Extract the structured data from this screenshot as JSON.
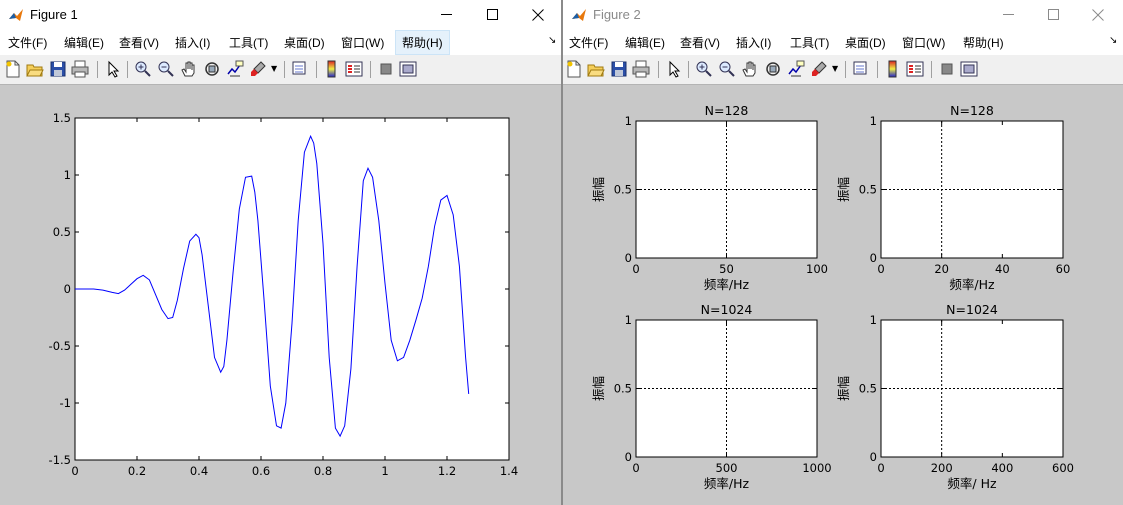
{
  "windows": [
    {
      "title": "Figure 1",
      "menus": [
        "文件(F)",
        "编辑(E)",
        "查看(V)",
        "插入(I)",
        "工具(T)",
        "桌面(D)",
        "窗口(W)",
        "帮助(H)"
      ],
      "highlighted_menu": "帮助(H)"
    },
    {
      "title": "Figure 2",
      "menus": [
        "文件(F)",
        "编辑(E)",
        "查看(V)",
        "插入(I)",
        "工具(T)",
        "桌面(D)",
        "窗口(W)",
        "帮助(H)"
      ]
    }
  ],
  "toolbar_icons": [
    "new-figure-icon",
    "open-file-icon",
    "save-icon",
    "print-icon",
    "edit-plot-arrow-icon",
    "zoom-in-icon",
    "zoom-out-icon",
    "pan-hand-icon",
    "rotate-3d-icon",
    "data-cursor-icon",
    "brush-icon",
    "link-plot-icon",
    "colorbar-icon",
    "legend-icon",
    "hide-plot-tools-icon",
    "show-plot-tools-icon"
  ],
  "colors": {
    "series": "#0000ff",
    "figure_bg": "#c8c8c8",
    "axes_bg": "#ffffff",
    "matlab_orange": "#e8780c"
  },
  "chart_data": [
    {
      "type": "line",
      "figure": "Figure 1",
      "title": "",
      "xlabel": "",
      "ylabel": "",
      "xlim": [
        0,
        1.4
      ],
      "ylim": [
        -1.5,
        1.5
      ],
      "xticks": [
        "0",
        "0.2",
        "0.4",
        "0.6",
        "0.8",
        "1",
        "1.2",
        "1.4"
      ],
      "yticks": [
        "1.5",
        "1",
        "0.5",
        "0",
        "-0.5",
        "-1",
        "-1.5"
      ],
      "grid": false,
      "series": [
        {
          "x": [
            0,
            0.03,
            0.06,
            0.09,
            0.12,
            0.14,
            0.16,
            0.18,
            0.2,
            0.22,
            0.24,
            0.26,
            0.28,
            0.3,
            0.315,
            0.33,
            0.35,
            0.37,
            0.39,
            0.4,
            0.41,
            0.43,
            0.45,
            0.47,
            0.48,
            0.49,
            0.51,
            0.53,
            0.55,
            0.57,
            0.58,
            0.59,
            0.61,
            0.63,
            0.65,
            0.665,
            0.68,
            0.7,
            0.72,
            0.74,
            0.76,
            0.77,
            0.78,
            0.8,
            0.82,
            0.84,
            0.855,
            0.87,
            0.89,
            0.91,
            0.93,
            0.945,
            0.96,
            0.98,
            1.0,
            1.02,
            1.04,
            1.06,
            1.08,
            1.1,
            1.12,
            1.14,
            1.16,
            1.18,
            1.2,
            1.22,
            1.24,
            1.26,
            1.27
          ],
          "y": [
            0,
            0,
            0,
            -0.01,
            -0.03,
            -0.04,
            -0.01,
            0.04,
            0.09,
            0.12,
            0.08,
            -0.05,
            -0.18,
            -0.26,
            -0.25,
            -0.1,
            0.18,
            0.42,
            0.48,
            0.45,
            0.3,
            -0.15,
            -0.6,
            -0.73,
            -0.68,
            -0.45,
            0.15,
            0.7,
            0.98,
            0.99,
            0.85,
            0.6,
            -0.1,
            -0.85,
            -1.2,
            -1.22,
            -1.0,
            -0.3,
            0.6,
            1.2,
            1.34,
            1.28,
            1.1,
            0.4,
            -0.6,
            -1.22,
            -1.29,
            -1.2,
            -0.7,
            0.2,
            0.95,
            1.06,
            0.98,
            0.6,
            0.05,
            -0.45,
            -0.63,
            -0.6,
            -0.45,
            -0.27,
            -0.08,
            0.2,
            0.55,
            0.78,
            0.82,
            0.65,
            0.2,
            -0.6,
            -0.92
          ]
        }
      ]
    },
    {
      "type": "line",
      "figure": "Figure 2",
      "title": "N=128",
      "xlabel": "频率/Hz",
      "ylabel": "振幅",
      "xlim": [
        0,
        100
      ],
      "ylim": [
        0,
        1
      ],
      "xticks": [
        "0",
        "50",
        "100"
      ],
      "yticks": [
        "1",
        "0.5",
        "0"
      ],
      "crosshair": {
        "x": 50,
        "y": 0.5
      },
      "series": []
    },
    {
      "type": "line",
      "figure": "Figure 2",
      "title": "N=128",
      "xlabel": "频率/Hz",
      "ylabel": "振幅",
      "xlim": [
        0,
        60
      ],
      "ylim": [
        0,
        1
      ],
      "xticks": [
        "0",
        "20",
        "40",
        "60"
      ],
      "yticks": [
        "1",
        "0.5",
        "0"
      ],
      "crosshair": {
        "x": 20,
        "y": 0.5
      },
      "series": []
    },
    {
      "type": "line",
      "figure": "Figure 2",
      "title": "N=1024",
      "xlabel": "频率/Hz",
      "ylabel": "振幅",
      "xlim": [
        0,
        1000
      ],
      "ylim": [
        0,
        1
      ],
      "xticks": [
        "0",
        "500",
        "1000"
      ],
      "yticks": [
        "1",
        "0.5",
        "0"
      ],
      "crosshair": {
        "x": 500,
        "y": 0.5
      },
      "series": []
    },
    {
      "type": "line",
      "figure": "Figure 2",
      "title": "N=1024",
      "xlabel": "频率/ Hz",
      "ylabel": "振幅",
      "xlim": [
        0,
        600
      ],
      "ylim": [
        0,
        1
      ],
      "xticks": [
        "0",
        "200",
        "400",
        "600"
      ],
      "yticks": [
        "1",
        "0.5",
        "0"
      ],
      "crosshair": {
        "x": 200,
        "y": 0.5
      },
      "series": []
    }
  ]
}
